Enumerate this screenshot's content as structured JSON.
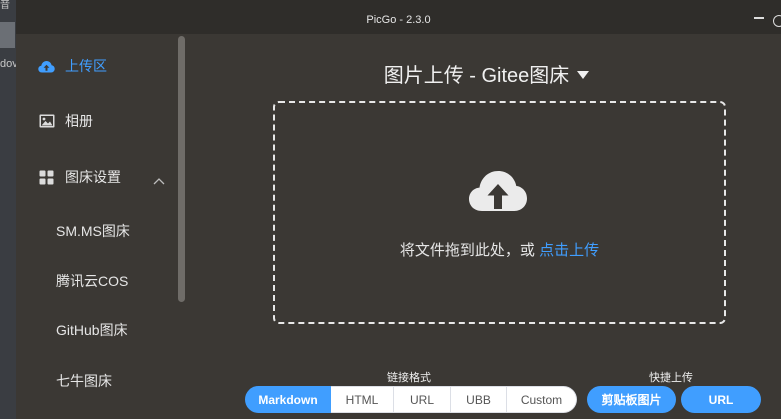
{
  "background_window": {
    "text_top": "音",
    "text_side": "dov"
  },
  "window": {
    "title": "PicGo - 2.3.0"
  },
  "sidebar": {
    "items": [
      {
        "label": "上传区",
        "icon": "cloud-upload-icon"
      },
      {
        "label": "相册",
        "icon": "picture-icon"
      },
      {
        "label": "图床设置",
        "icon": "grid-icon"
      }
    ],
    "sub_items": [
      "SM.MS图床",
      "腾讯云COS",
      "GitHub图床",
      "七牛图床"
    ]
  },
  "main": {
    "heading": "图片上传 - Gitee图床",
    "drop_text": "将文件拖到此处，或 ",
    "drop_link": "点击上传",
    "format_label": "链接格式",
    "formats": [
      "Markdown",
      "HTML",
      "URL",
      "UBB",
      "Custom"
    ],
    "selected_format": "Markdown",
    "quick_label": "快捷上传",
    "quick_buttons": [
      "剪贴板图片",
      "URL"
    ]
  },
  "colors": {
    "accent": "#409eff",
    "background": "#3b3834",
    "titlebar": "#2f2d2a"
  }
}
